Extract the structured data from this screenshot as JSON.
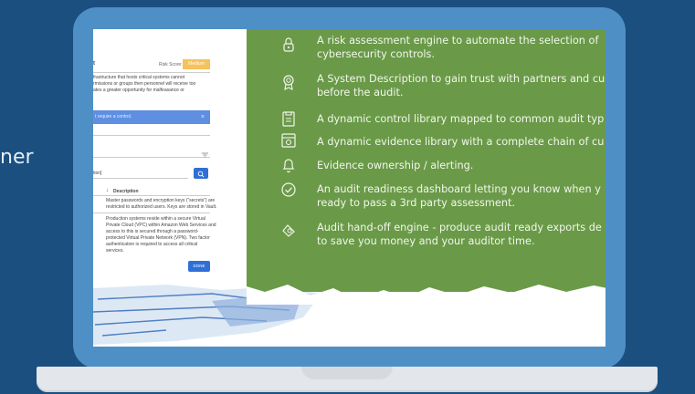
{
  "background": {
    "word": "ner"
  },
  "app": {
    "risk_score_label": "Risk Score:",
    "risk_badge": "Medium",
    "desc_lines": [
      "frastructure that hosts critical systems cannot",
      "rmissions or groups then personnel will receive too",
      "ates a greater opportunity for malfeasance or"
    ],
    "alert_text": "t require a control.",
    "alert_close": "×",
    "search_value": "tion]",
    "column_header": "Description",
    "row1": [
      "Master passwords and encryption keys (“secrets”) are",
      "restricted to authorized users. Keys are stored in Vault."
    ],
    "row2": [
      "Production systems reside within a secure Virtual",
      "Private Cloud (VPC) within Amazon Web Services and",
      "access to this is secured through a password-",
      "protected Virtual Private Network (VPN). Two factor",
      "authentication is required to access all critical",
      "services."
    ],
    "done_label": "DONE"
  },
  "features": [
    {
      "icon": "lock-icon",
      "lines": [
        "A risk assessment engine to automate the selection of",
        "cybersecurity controls."
      ]
    },
    {
      "icon": "badge-icon",
      "lines": [
        "A System Description to gain trust with partners and cus",
        "before the audit."
      ]
    },
    {
      "icon": "clipboard-icon",
      "lines": [
        "A dynamic control library mapped to common audit typ"
      ]
    },
    {
      "icon": "evidence-icon",
      "lines": [
        "A dynamic evidence library with a complete chain of cu"
      ]
    },
    {
      "icon": "bell-icon",
      "lines": [
        "Evidence ownership / alerting."
      ]
    },
    {
      "icon": "check-circle-icon",
      "lines": [
        "An audit readiness dashboard letting you know when y",
        "ready to pass a 3rd party assessment."
      ]
    },
    {
      "icon": "handoff-icon",
      "lines": [
        "Audit hand-off engine - produce audit ready exports de",
        "to save you money and your auditor time."
      ]
    }
  ],
  "colors": {
    "background": "#1a4f80",
    "laptop": "#4e8fc6",
    "panel_green": "#6a9a48",
    "badge": "#f5c25b",
    "button": "#2f6fd6"
  }
}
